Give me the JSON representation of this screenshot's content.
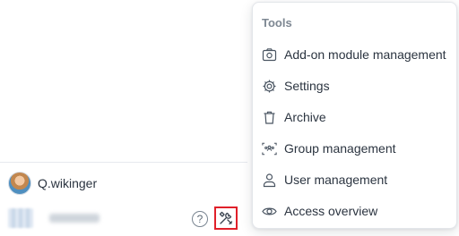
{
  "user": {
    "name": "Q.wikinger"
  },
  "tenant": {
    "name": ""
  },
  "footer": {
    "help_icon": "question-circle-icon",
    "help_glyph": "?",
    "tools_icon": "tools-icon"
  },
  "menu": {
    "title": "Tools",
    "items": [
      {
        "label": "Add-on module management",
        "icon": "camera-box-icon"
      },
      {
        "label": "Settings",
        "icon": "gear-icon"
      },
      {
        "label": "Archive",
        "icon": "trash-icon"
      },
      {
        "label": "Group management",
        "icon": "group-icon"
      },
      {
        "label": "User management",
        "icon": "user-icon"
      },
      {
        "label": "Access overview",
        "icon": "eye-icon"
      }
    ]
  },
  "colors": {
    "highlight_border": "#e0202a",
    "text": "#2b3440",
    "muted": "#7d8792"
  }
}
